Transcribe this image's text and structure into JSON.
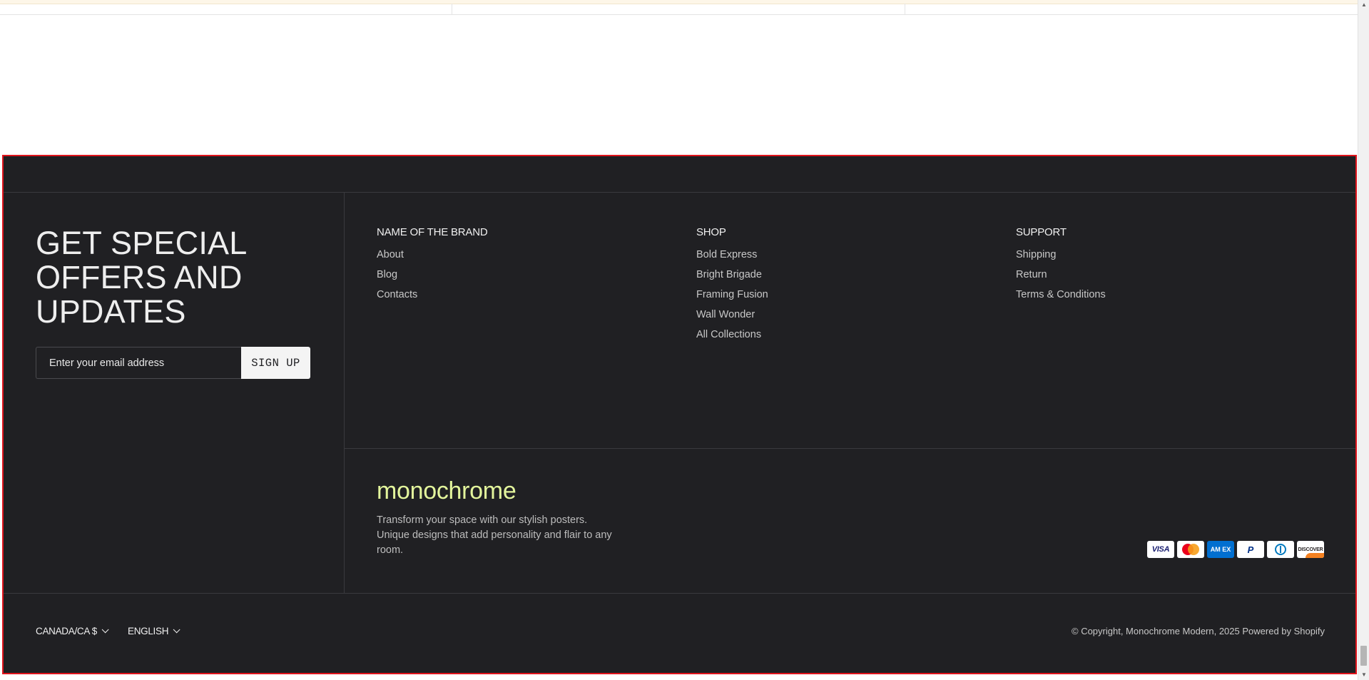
{
  "newsletter": {
    "title": "GET SPECIAL OFFERS AND UPDATES",
    "email_placeholder": "Enter your email address",
    "signup_label": "SIGN UP"
  },
  "columns": {
    "brand": {
      "title": "NAME OF THE BRAND",
      "links": [
        "About",
        "Blog",
        "Contacts"
      ]
    },
    "shop": {
      "title": "SHOP",
      "links": [
        "Bold Express",
        "Bright Brigade",
        "Framing Fusion",
        "Wall Wonder",
        "All Collections"
      ]
    },
    "support": {
      "title": "SUPPORT",
      "links": [
        "Shipping",
        "Return",
        "Terms & Conditions"
      ]
    }
  },
  "brand": {
    "logo_text": "monochrome",
    "description": "Transform your space with our stylish posters. Unique designs that add personality and flair to any room."
  },
  "payment_methods": {
    "visa": "VISA",
    "mastercard": "mastercard-icon",
    "amex": "AM EX",
    "paypal": "P",
    "diners": "diners-club-icon",
    "discover": "DISCOVER"
  },
  "bottom": {
    "country": "CANADA/CA $",
    "language": "ENGLISH",
    "copyright": "© Copyright, Monochrome Modern, 2025 Powered by Shopify"
  },
  "colors": {
    "footer_bg": "#202023",
    "logo_accent": "#e3f59c",
    "selection_outline": "#e0141c"
  }
}
